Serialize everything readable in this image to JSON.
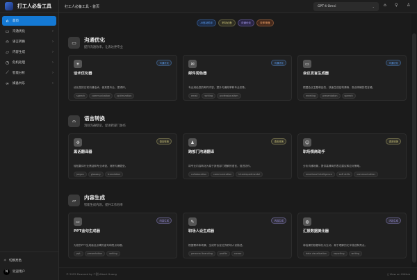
{
  "app": {
    "title": "打工人必备工具",
    "header_title": "打工人必备工具 - 首页"
  },
  "sidebar": {
    "items": [
      {
        "label": "首页",
        "icon": "home-icon",
        "active": true
      },
      {
        "label": "沟通优化",
        "icon": "chat-icon"
      },
      {
        "label": "语言转换",
        "icon": "translate-icon"
      },
      {
        "label": "内容生成",
        "icon": "folder-icon"
      },
      {
        "label": "危机处理",
        "icon": "alert-icon"
      },
      {
        "label": "智能分析",
        "icon": "chart-icon"
      },
      {
        "label": "媒备共乐",
        "icon": "link-icon"
      }
    ],
    "bottom": {
      "theme_label": "切换亮色",
      "user_label": "欢迎用户",
      "avatar_letter": "N"
    }
  },
  "header": {
    "model": "GPT-4 Omni"
  },
  "badges": [
    {
      "label": "AI驱动助手",
      "color": "#5b9cf0",
      "bg": "#1c2b45"
    },
    {
      "label": "职场必备",
      "color": "#c9c27a",
      "bg": "#2f2e22"
    },
    {
      "label": "沟通优化",
      "color": "#a89cf0",
      "bg": "#2a2545"
    },
    {
      "label": "效率神器",
      "color": "#f0a36a",
      "bg": "#45291b"
    }
  ],
  "sections": [
    {
      "title": "沟通优化",
      "subtitle": "提升沟通效率，让表达更专业",
      "icon": "chat-icon",
      "tag_color": "#5b9cf0",
      "cards": [
        {
          "title": "话术优化器",
          "tag": "沟通优化",
          "icon": "lightbulb-icon",
          "desc": "优化您的日常沟通话术，使其更专业、更得体。",
          "tags": [
            "speech",
            "communication",
            "optimization"
          ]
        },
        {
          "title": "邮件润色器",
          "tag": "沟通优化",
          "icon": "mail-icon",
          "desc": "专业润色您的邮件内容，提升沟通效率和专业形象。",
          "tags": [
            "email",
            "writing",
            "professionalism"
          ]
        },
        {
          "title": "会议发言生成器",
          "tag": "沟通优化",
          "icon": "presentation-icon",
          "desc": "根据会议主题和目的，快速生成结构清晰、观点明确的发言稿。",
          "tags": [
            "meeting",
            "presentation",
            "speech"
          ]
        }
      ]
    },
    {
      "title": "语言转换",
      "subtitle": "消除沟通壁垒，促进跨部门协作",
      "icon": "robot-icon",
      "tag_color": "#c9c27a",
      "cards": [
        {
          "title": "黑话翻译器",
          "tag": "语言转换",
          "icon": "puzzle-icon",
          "desc": "轻松翻译行业黑话和专业术语，消除沟通壁垒。",
          "tags": [
            "jargon",
            "glossary",
            "translation"
          ]
        },
        {
          "title": "跨部门沟通翻译",
          "tag": "语言转换",
          "icon": "team-icon",
          "desc": "将专业内容转化为易于其他部门理解的语言，促进协作。",
          "tags": [
            "collaboration",
            "communication",
            "interdepartmental"
          ]
        },
        {
          "title": "职场情商助手",
          "tag": "语言转换",
          "icon": "smile-icon",
          "desc": "分析沟通场景，提供高情商的表达建议和应对策略。",
          "tags": [
            "emotional intelligence",
            "soft skills",
            "communication"
          ]
        }
      ]
    },
    {
      "title": "内容生成",
      "subtitle": "智能生成内容，提升工作效率",
      "icon": "folder-icon",
      "tag_color": "#a89cf0",
      "cards": [
        {
          "title": "PPT金句生成器",
          "tag": "内容生成",
          "icon": "monitor-icon",
          "desc": "为您的PPT生成画龙点睛的金句和亮点标题。",
          "tags": [
            "ppt",
            "presentation",
            "writing"
          ]
        },
        {
          "title": "职场人设生成器",
          "tag": "内容生成",
          "icon": "user-edit-icon",
          "desc": "根据需求和场景，生成符合定位的职场人设描述。",
          "tags": [
            "personal branding",
            "profile",
            "career"
          ]
        },
        {
          "title": "汇报数据美化器",
          "tag": "内容生成",
          "icon": "palette-icon",
          "desc": "将枯燥的数据转化为生动、易于理解的文字描述和亮点。",
          "tags": [
            "data visualization",
            "reporting",
            "writing"
          ]
        }
      ]
    }
  ],
  "footer": {
    "copyright": "© 2025 Powered by 二割 Albert Huang",
    "github": "View on GitHub"
  }
}
